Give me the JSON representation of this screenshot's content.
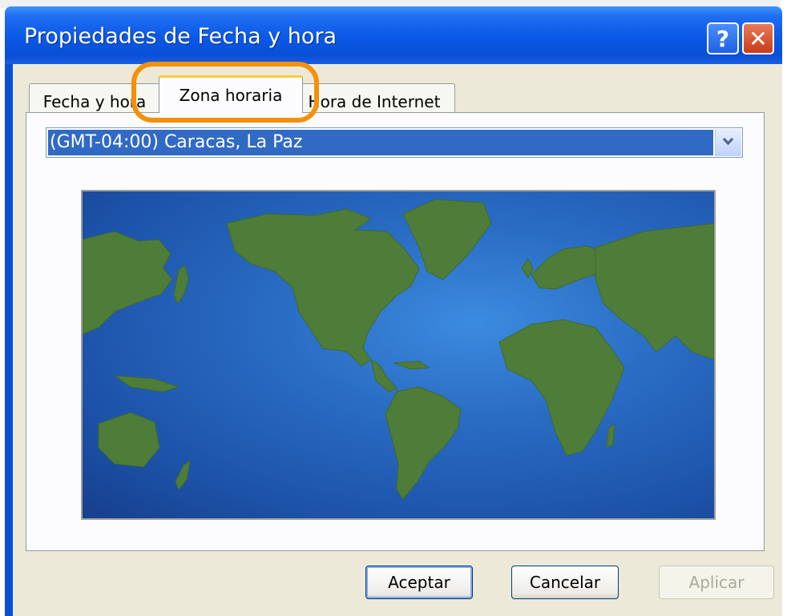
{
  "window": {
    "title": "Propiedades de Fecha y hora",
    "help_icon": "?",
    "close_icon": "✕"
  },
  "tabs": [
    {
      "label": "Fecha y hora",
      "selected": false
    },
    {
      "label": "Zona horaria",
      "selected": true
    },
    {
      "label": "Hora de Internet",
      "selected": false
    }
  ],
  "timezone": {
    "selected": "(GMT-04:00) Caracas, La Paz"
  },
  "map": {
    "icon": "world-map"
  },
  "buttons": {
    "ok": "Aceptar",
    "cancel": "Cancelar",
    "apply": "Aplicar",
    "apply_enabled": false
  },
  "colors": {
    "highlight": "#f5900a",
    "land": "#4e7d3a",
    "ocean": "#2a6cc4"
  }
}
